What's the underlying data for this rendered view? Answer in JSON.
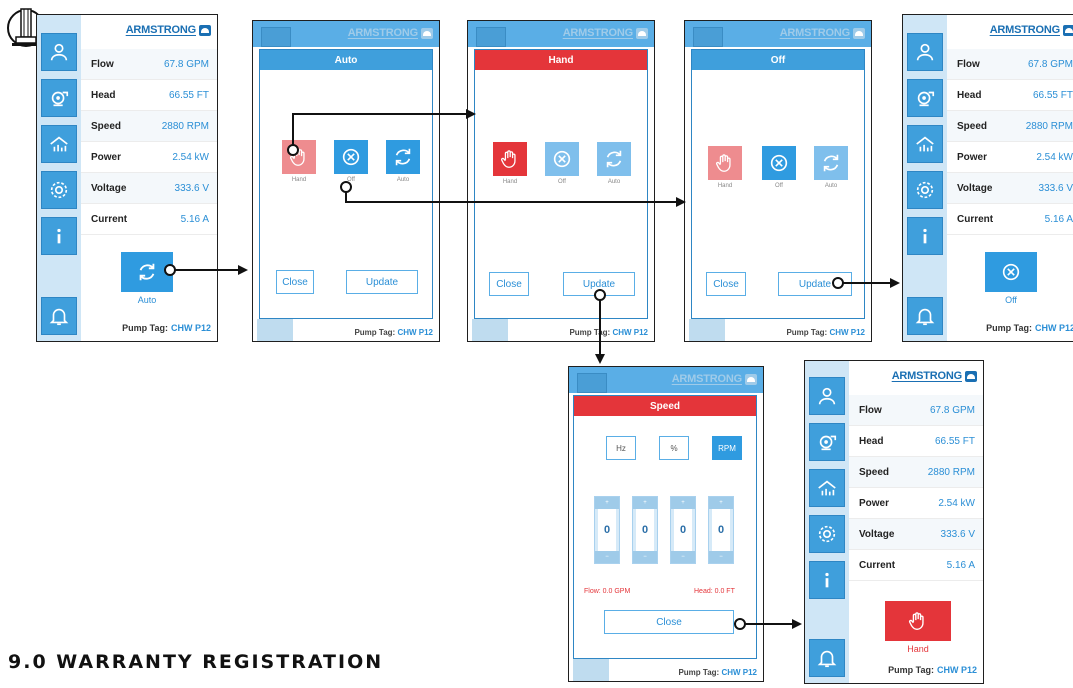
{
  "brand": {
    "name": "ARMSTRONG"
  },
  "readings": [
    {
      "label": "Flow",
      "value": "67.8 GPM"
    },
    {
      "label": "Head",
      "value": "66.55 FT"
    },
    {
      "label": "Speed",
      "value": "2880 RPM"
    },
    {
      "label": "Power",
      "value": "2.54 kW"
    },
    {
      "label": "Voltage",
      "value": "333.6 V"
    },
    {
      "label": "Current",
      "value": "5.16 A"
    }
  ],
  "footer": {
    "tag_label": "Pump Tag:",
    "tag_value": "CHW P12"
  },
  "modes": {
    "hand": "Hand",
    "off": "Off",
    "auto": "Auto"
  },
  "popups": {
    "auto_title": "Auto",
    "hand_title": "Hand",
    "off_title": "Off",
    "speed_title": "Speed"
  },
  "buttons": {
    "close": "Close",
    "update": "Update"
  },
  "speed": {
    "units": [
      "Hz",
      "%",
      "RPM"
    ],
    "active_unit": "RPM",
    "digits": [
      "0",
      "0",
      "0",
      "0"
    ],
    "flow_text": "Flow: 0.0 GPM",
    "head_text": "Head: 0.0 FT"
  },
  "screen1": {
    "mode_label": "Auto"
  },
  "screen5": {
    "mode_label": "Off"
  },
  "screen7": {
    "mode_label": "Hand"
  },
  "section": {
    "title": "9.0 WARRANTY REGISTRATION"
  },
  "colors": {
    "accent": "#2f9be0",
    "hand_red": "#e4353a",
    "sidebar": "#cfe6f6"
  }
}
